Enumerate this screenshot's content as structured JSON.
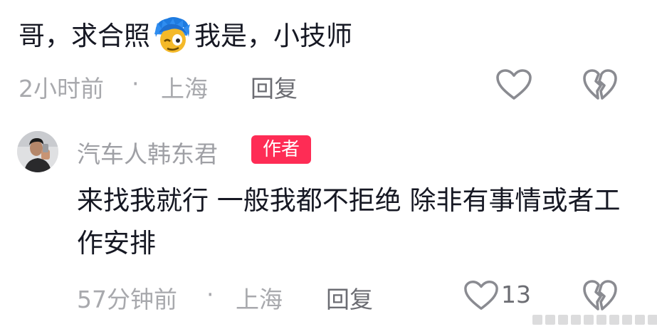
{
  "comment1": {
    "text_before": "哥，求合照",
    "emoji": "blue-haired-face-emoji",
    "text_after": "我是，小技师",
    "time": "2小时前",
    "separator": "·",
    "location": "上海",
    "reply_label": "回复"
  },
  "comment2": {
    "author": "汽车人韩东君",
    "author_badge": "作者",
    "text": "来找我就行  一般我都不拒绝  除非有事情或者工作安排",
    "time": "57分钟前",
    "separator": "·",
    "location": "上海",
    "reply_label": "回复",
    "like_count": "13"
  },
  "colors": {
    "badge": "#fe2c55",
    "meta": "#a8a9ad",
    "text": "#161823"
  }
}
